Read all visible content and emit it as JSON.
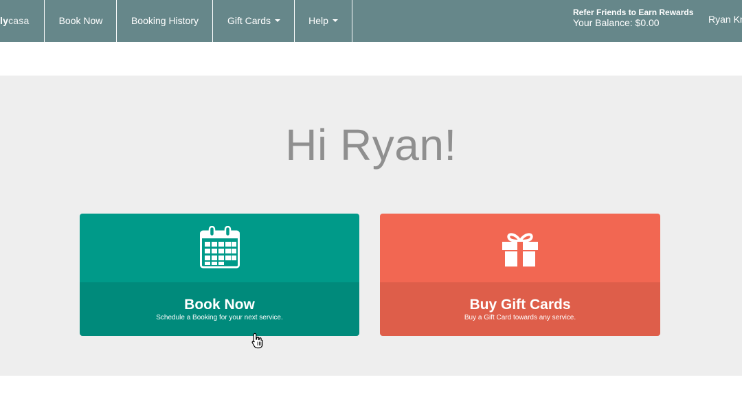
{
  "navbar": {
    "brand_bold": "ly",
    "brand_light": "casa",
    "items": [
      {
        "label": "Book Now"
      },
      {
        "label": "Booking History"
      },
      {
        "label": "Gift Cards"
      },
      {
        "label": "Help"
      }
    ],
    "refer_label": "Refer Friends to Earn Rewards",
    "balance_label": "Your Balance: $0.00",
    "user_name": "Ryan Kr"
  },
  "hero": {
    "greeting": "Hi Ryan!"
  },
  "cards": {
    "book": {
      "icon": "calendar-icon",
      "title": "Book Now",
      "subtitle": "Schedule a Booking for your next service."
    },
    "gift": {
      "icon": "gift-icon",
      "title": "Buy Gift Cards",
      "subtitle": "Buy a Gift Card towards any service."
    }
  },
  "colors": {
    "navbar": "#66878a",
    "book_top": "#009a89",
    "book_bottom": "#008a7b",
    "gift_top": "#f26752",
    "gift_bottom": "#de5e4a",
    "hero_bg": "#eeeeee",
    "greeting_text": "#8f8f8f"
  }
}
